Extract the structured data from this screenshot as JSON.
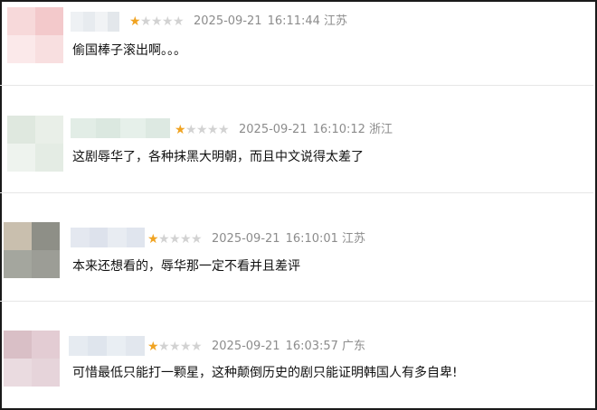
{
  "colors": {
    "star_on": "#f0a321",
    "star_off": "#d2d2d2",
    "meta_text": "#8c8c8c",
    "body_text": "#111111"
  },
  "comments": [
    {
      "rating": 1,
      "max_rating": 5,
      "date": "2025-09-21",
      "time": "16:11:44",
      "location": "江苏",
      "text": "偷国棒子滚出啊。。。",
      "avatar_colors": [
        "#f7d9da",
        "#f3c9cb",
        "#fbe9ea",
        "#f8dfe0"
      ],
      "name_colors": [
        "#eef1f4",
        "#e7ebef",
        "#f1f3f5",
        "#e3e7eb"
      ]
    },
    {
      "rating": 1,
      "max_rating": 5,
      "date": "2025-09-21",
      "time": "16:10:12",
      "location": "浙江",
      "text": "这剧辱华了，各种抹黑大明朝，而且中文说得太差了",
      "avatar_colors": [
        "#dfe8df",
        "#e9efe8",
        "#eef3ee",
        "#e4ece4"
      ],
      "name_colors": [
        "#e2ede6",
        "#dbe8e0",
        "#e6f0ea",
        "#dde9e2"
      ]
    },
    {
      "rating": 1,
      "max_rating": 5,
      "date": "2025-09-21",
      "time": "16:10:01",
      "location": "江苏",
      "text": "本来还想看的，辱华那一定不看并且差评",
      "avatar_colors": [
        "#c9bfae",
        "#8e8f87",
        "#a4a69e",
        "#9c9d96"
      ],
      "name_colors": [
        "#e4e8f0",
        "#dde2ec",
        "#e8ecf2",
        "#e0e5ee"
      ]
    },
    {
      "rating": 1,
      "max_rating": 5,
      "date": "2025-09-21",
      "time": "16:03:57",
      "location": "广东",
      "text": "可惜最低只能打一颗星，这种颠倒历史的剧只能证明韩国人有多自卑!",
      "avatar_colors": [
        "#d9bfc6",
        "#e3ccd3",
        "#eadbe0",
        "#e6d4da"
      ],
      "name_colors": [
        "#e6ebf1",
        "#dfe5ed",
        "#e9eef3",
        "#e2e7ee"
      ]
    }
  ]
}
